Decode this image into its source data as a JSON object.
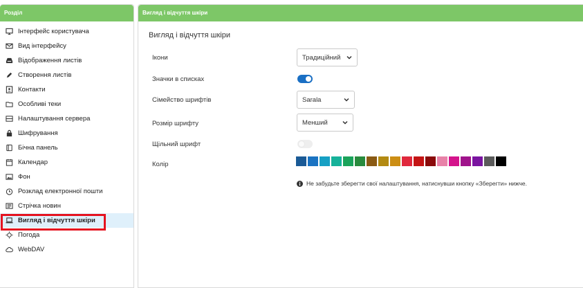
{
  "sidebar": {
    "header": "Розділ",
    "items": [
      {
        "label": "Інтерфейс користувача",
        "icon": "monitor-icon"
      },
      {
        "label": "Вид інтерфейсу",
        "icon": "envelope-icon"
      },
      {
        "label": "Відображення листів",
        "icon": "inbox-icon"
      },
      {
        "label": "Створення листів",
        "icon": "pencil-icon"
      },
      {
        "label": "Контакти",
        "icon": "contact-card-icon"
      },
      {
        "label": "Особливі теки",
        "icon": "folder-icon"
      },
      {
        "label": "Налаштування сервера",
        "icon": "server-icon"
      },
      {
        "label": "Шифрування",
        "icon": "lock-icon"
      },
      {
        "label": "Бічна панель",
        "icon": "sidebar-panel-icon"
      },
      {
        "label": "Календар",
        "icon": "calendar-icon"
      },
      {
        "label": "Фон",
        "icon": "image-icon"
      },
      {
        "label": "Розклад електронної пошти",
        "icon": "clock-icon"
      },
      {
        "label": "Стрічка новин",
        "icon": "newspaper-icon"
      },
      {
        "label": "Вигляд і відчуття шкіри",
        "icon": "laptop-icon"
      },
      {
        "label": "Погода",
        "icon": "sun-icon"
      },
      {
        "label": "WebDAV",
        "icon": "cloud-icon"
      }
    ]
  },
  "main": {
    "header": "Вигляд і відчуття шкіри",
    "section_title": "Вигляд і відчуття шкіри",
    "icons": {
      "label": "Ікони",
      "value": "Традиційний"
    },
    "list_icons": {
      "label": "Значки в списках",
      "state": "on"
    },
    "font_family": {
      "label": "Сімейство шрифтів",
      "value": "Sarala"
    },
    "font_size": {
      "label": "Розмір шрифту",
      "value": "Менший"
    },
    "dense_font": {
      "label": "Щільний шрифт",
      "state": "off"
    },
    "color": {
      "label": "Колір",
      "swatches": [
        "#1a5a96",
        "#1a73c2",
        "#17a0c4",
        "#16b29a",
        "#1aa35a",
        "#288a3d",
        "#8a5a14",
        "#b38a12",
        "#cc8e14",
        "#e0283c",
        "#c41414",
        "#8a0a0a",
        "#e882a8",
        "#d4148c",
        "#a0148c",
        "#7a14a0",
        "#5a5a5a",
        "#000000"
      ]
    },
    "note": "Не забудьте зберегти свої налаштування, натиснувши кнопку «Зберегти» нижче."
  },
  "colors": {
    "header_green": "#7dc767",
    "active_bg": "#dff0fb",
    "highlight_red": "#e5121f",
    "toggle_blue": "#1a6fc4"
  }
}
